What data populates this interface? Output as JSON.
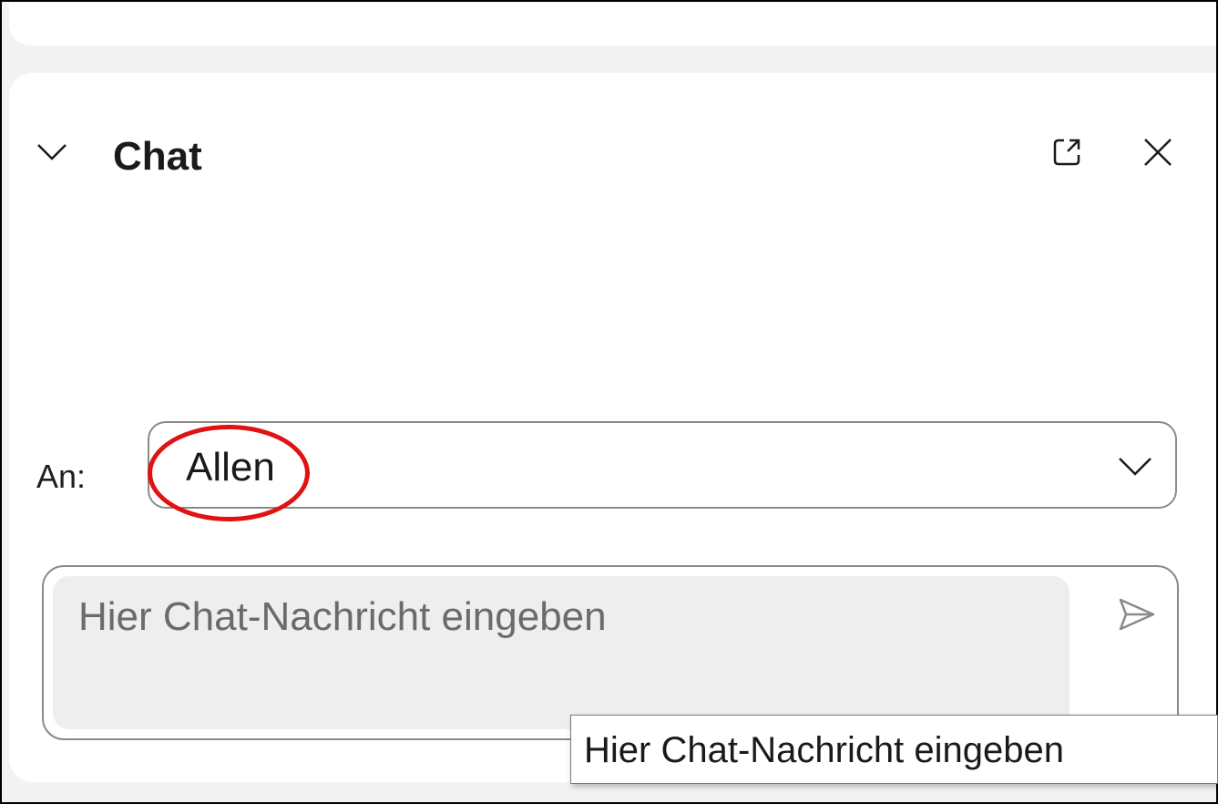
{
  "panel": {
    "title": "Chat",
    "icons": {
      "collapse": "chevron-down-icon",
      "popout": "popout-icon",
      "close": "close-icon"
    }
  },
  "recipient": {
    "label": "An:",
    "selected": "Allen",
    "icon": "chevron-down-icon"
  },
  "composer": {
    "placeholder": "Hier Chat-Nachricht eingeben",
    "value": "",
    "send_icon": "send-icon"
  },
  "tooltip": {
    "text": "Hier Chat-Nachricht eingeben"
  },
  "annotation": {
    "highlight_color": "#e01212"
  }
}
